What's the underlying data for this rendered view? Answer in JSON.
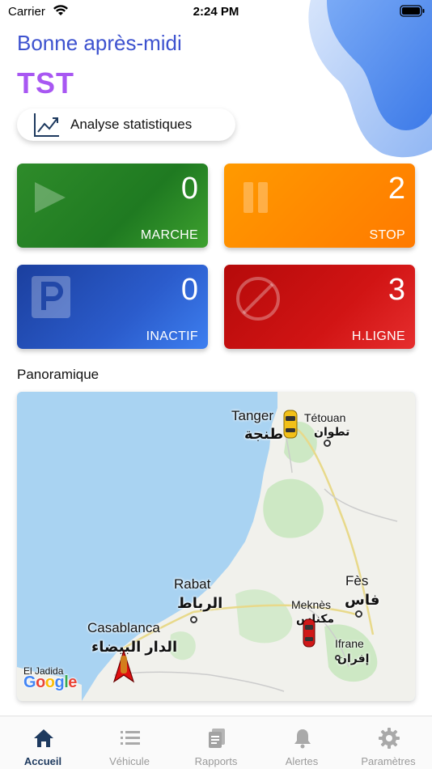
{
  "status_bar": {
    "carrier": "Carrier",
    "time": "2:24 PM"
  },
  "header": {
    "greeting": "Bonne après-midi",
    "company": "TST"
  },
  "stats_button": {
    "label": "Analyse statistiques"
  },
  "cards": [
    {
      "id": "marche",
      "count": "0",
      "label": "MARCHE",
      "color": "#2a8a27"
    },
    {
      "id": "stop",
      "count": "2",
      "label": "STOP",
      "color": "#ff8800"
    },
    {
      "id": "inactif",
      "count": "0",
      "label": "INACTIF",
      "color": "#2250bb"
    },
    {
      "id": "hligne",
      "count": "3",
      "label": "H.LIGNE",
      "color": "#cc1111"
    }
  ],
  "panorama": {
    "title": "Panoramique",
    "cities": {
      "tanger": "Tanger",
      "tanger_ar": "طنجة",
      "tetouan": "Tétouan",
      "tetouan_ar": "تطوان",
      "rabat": "Rabat",
      "rabat_ar": "الرباط",
      "casablanca": "Casablanca",
      "casablanca_ar": "الدار البيضاء",
      "fes": "Fès",
      "fes_ar": "فاس",
      "meknes": "Meknès",
      "meknes_ar": "مكناس",
      "ifrane": "Ifrane",
      "ifrane_ar": "إفران",
      "el_jadida": "El Jadida"
    },
    "map_colors": {
      "sea": "#a9d3f2",
      "land": "#f1f1ec",
      "green": "#cde8c4"
    }
  },
  "tabbar": {
    "active": "accueil",
    "items": [
      {
        "id": "accueil",
        "label": "Accueil",
        "icon": "home-icon"
      },
      {
        "id": "vehicule",
        "label": "Véhicule",
        "icon": "list-icon"
      },
      {
        "id": "rapports",
        "label": "Rapports",
        "icon": "report-icon"
      },
      {
        "id": "alertes",
        "label": "Alertes",
        "icon": "bell-icon"
      },
      {
        "id": "parametres",
        "label": "Paramètres",
        "icon": "gear-icon"
      }
    ]
  }
}
